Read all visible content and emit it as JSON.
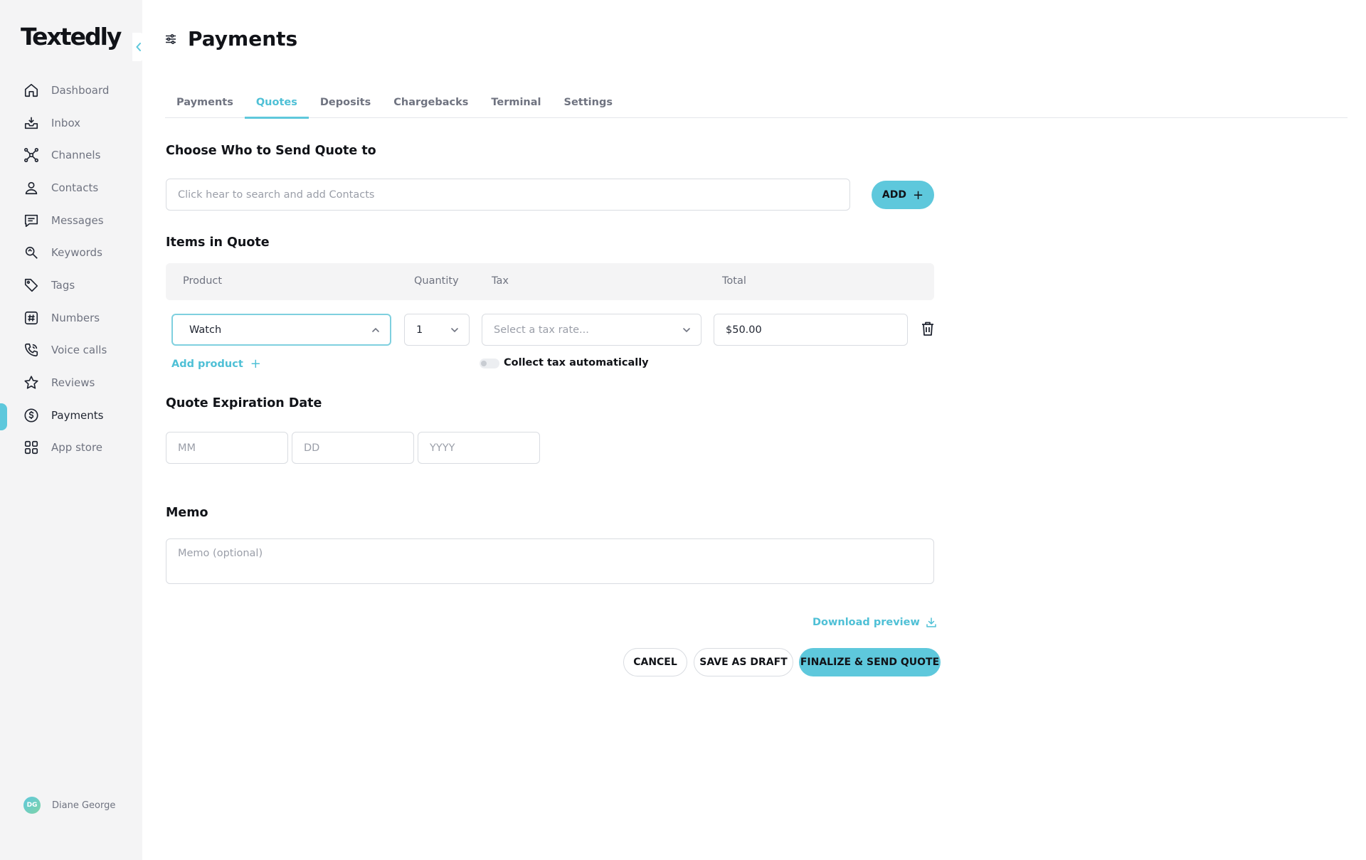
{
  "app": {
    "logo": "Textedly"
  },
  "sidebar": {
    "items": [
      {
        "label": "Dashboard",
        "icon": "home-icon"
      },
      {
        "label": "Inbox",
        "icon": "inbox-icon"
      },
      {
        "label": "Channels",
        "icon": "channels-icon"
      },
      {
        "label": "Contacts",
        "icon": "person-icon"
      },
      {
        "label": "Messages",
        "icon": "message-icon"
      },
      {
        "label": "Keywords",
        "icon": "keyword-icon"
      },
      {
        "label": "Tags",
        "icon": "tag-icon"
      },
      {
        "label": "Numbers",
        "icon": "hash-icon"
      },
      {
        "label": "Voice calls",
        "icon": "phone-icon"
      },
      {
        "label": "Reviews",
        "icon": "star-icon"
      },
      {
        "label": "Payments",
        "icon": "dollar-icon",
        "active": true
      },
      {
        "label": "App store",
        "icon": "grid-icon"
      }
    ],
    "user": {
      "initials": "DG",
      "name": "Diane George"
    }
  },
  "header": {
    "title": "Payments"
  },
  "tabs": [
    {
      "label": "Payments"
    },
    {
      "label": "Quotes",
      "active": true
    },
    {
      "label": "Deposits"
    },
    {
      "label": "Chargebacks"
    },
    {
      "label": "Terminal"
    },
    {
      "label": "Settings"
    }
  ],
  "recipients": {
    "title": "Choose Who to Send Quote to",
    "search_placeholder": "Click hear to search and add Contacts",
    "add_label": "ADD"
  },
  "items": {
    "title": "Items in Quote",
    "columns": [
      "Product",
      "Quantity",
      "Tax",
      "Total"
    ],
    "row": {
      "product": "Watch",
      "quantity": "1",
      "tax_placeholder": "Select a tax rate...",
      "total": "$50.00"
    },
    "add_product_label": "Add product",
    "collect_tax_label": "Collect tax automatically"
  },
  "expiration": {
    "title": "Quote Expiration Date",
    "mm_placeholder": "MM",
    "dd_placeholder": "DD",
    "yyyy_placeholder": "YYYY"
  },
  "memo": {
    "title": "Memo",
    "placeholder": "Memo (optional)"
  },
  "actions": {
    "download_label": "Download preview",
    "cancel_label": "CANCEL",
    "draft_label": "SAVE AS DRAFT",
    "finalize_label": "FINALIZE & SEND QUOTE"
  },
  "colors": {
    "accent": "#5ec8dc",
    "accent_text": "#4fc0d6",
    "sidebar_bg": "#f4f4f5"
  }
}
